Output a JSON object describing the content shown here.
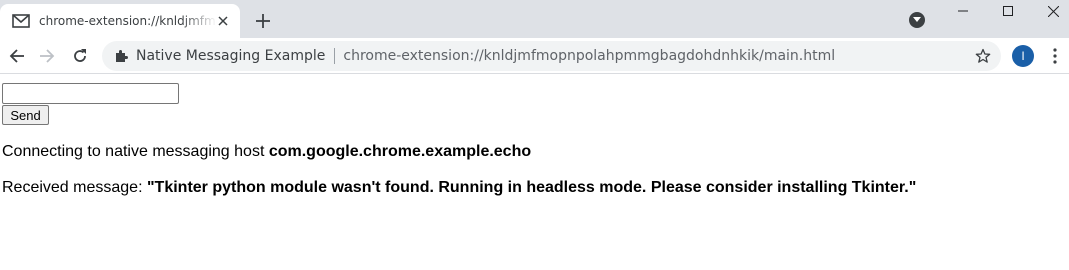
{
  "browser": {
    "tab": {
      "title": "chrome-extension://knldjmfmopnpolahpmmgbagdohdnhkik/main.html",
      "favicon": "gmail-envelope-icon"
    },
    "omnibox": {
      "site_name": "Native Messaging Example",
      "url": "chrome-extension://knldjmfmopnpolahpmmgbagdohdnhkik/main.html"
    },
    "profile_initial": "I",
    "colors": {
      "tabstrip_bg": "#dee1e6",
      "omnibox_bg": "#f1f3f4",
      "profile_bg": "#1a5fa8"
    }
  },
  "page": {
    "input": {
      "value": "",
      "placeholder": ""
    },
    "send_label": "Send",
    "connecting_prefix": "Connecting to native messaging host ",
    "host_name": "com.google.chrome.example.echo",
    "received_prefix": "Received message: ",
    "received_message": "\"Tkinter python module wasn't found. Running in headless mode. Please consider installing Tkinter.\""
  }
}
